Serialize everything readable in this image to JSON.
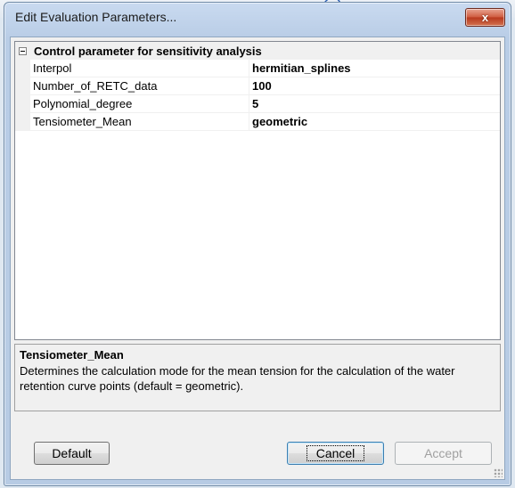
{
  "window": {
    "title": "Edit Evaluation Parameters...",
    "close_glyph": "x"
  },
  "grid": {
    "category": "Control parameter for sensitivity analysis",
    "properties": [
      {
        "name": "Interpol",
        "value": "hermitian_splines"
      },
      {
        "name": "Number_of_RETC_data",
        "value": "100"
      },
      {
        "name": "Polynomial_degree",
        "value": "5"
      },
      {
        "name": "Tensiometer_Mean",
        "value": "geometric"
      }
    ]
  },
  "help": {
    "title": "Tensiometer_Mean",
    "description": "Determines the calculation mode for the mean tension for the calculation of the water retention curve points (default = geometric)."
  },
  "buttons": {
    "default_label": "Default",
    "cancel_label": "Cancel",
    "accept_label": "Accept"
  }
}
